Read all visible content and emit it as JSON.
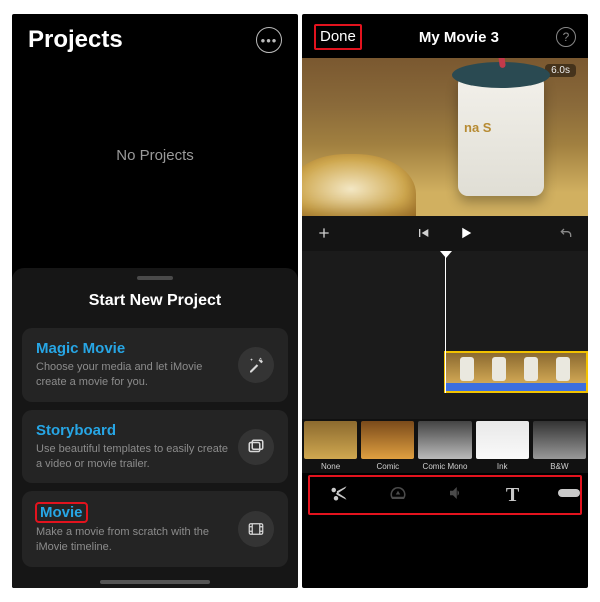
{
  "left": {
    "title": "Projects",
    "empty_state": "No Projects",
    "sheet_title": "Start New Project",
    "options": [
      {
        "title": "Magic Movie",
        "desc": "Choose your media and let iMovie create a movie for you.",
        "icon": "sparkle-wand-icon"
      },
      {
        "title": "Storyboard",
        "desc": "Use beautiful templates to easily create a video or movie trailer.",
        "icon": "storyboard-icon"
      },
      {
        "title": "Movie",
        "desc": "Make a movie from scratch with the iMovie timeline.",
        "icon": "film-icon"
      }
    ]
  },
  "right": {
    "done": "Done",
    "title": "My Movie 3",
    "duration": "6.0s",
    "filters": [
      {
        "name": "None",
        "bg": "linear-gradient(180deg,#8c6a2f,#d0a850)"
      },
      {
        "name": "Comic",
        "bg": "linear-gradient(180deg,#7a4a1a,#e0a040)"
      },
      {
        "name": "Comic Mono",
        "bg": "linear-gradient(180deg,#444,#bbb)"
      },
      {
        "name": "Ink",
        "bg": "linear-gradient(180deg,#e8e8e8,#fafafa)"
      },
      {
        "name": "B&W",
        "bg": "linear-gradient(180deg,#333,#999)"
      }
    ],
    "tools": [
      "cut",
      "speed",
      "volume",
      "text",
      "color"
    ]
  }
}
